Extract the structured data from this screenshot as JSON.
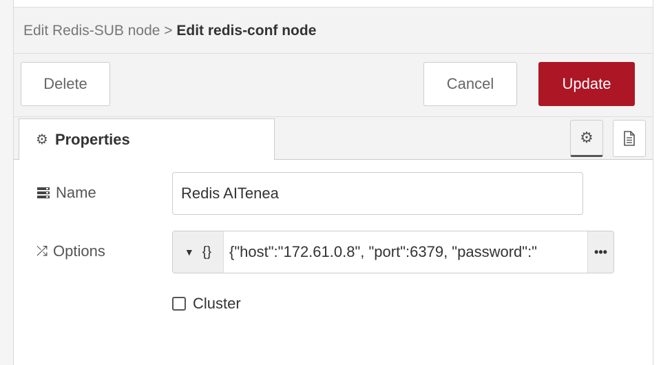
{
  "breadcrumb": {
    "parent": "Edit Redis-SUB node",
    "separator": " > ",
    "current": "Edit redis-conf node"
  },
  "toolbar": {
    "delete_label": "Delete",
    "cancel_label": "Cancel",
    "update_label": "Update"
  },
  "tabs": {
    "properties_label": "Properties",
    "properties_icon": "gear-icon",
    "settings_icon": "gear-icon",
    "description_icon": "file-text-icon"
  },
  "form": {
    "name": {
      "label": "Name",
      "icon": "server-icon",
      "value": "Redis AITenea"
    },
    "options": {
      "label": "Options",
      "icon": "random-icon",
      "type": "{}",
      "value": "{\"host\":\"172.61.0.8\", \"port\":6379, \"password\":\""
    },
    "cluster": {
      "label": "Cluster",
      "checked": false
    }
  },
  "colors": {
    "update_bg": "#ad1625",
    "header_bg": "#f3f3f3"
  }
}
